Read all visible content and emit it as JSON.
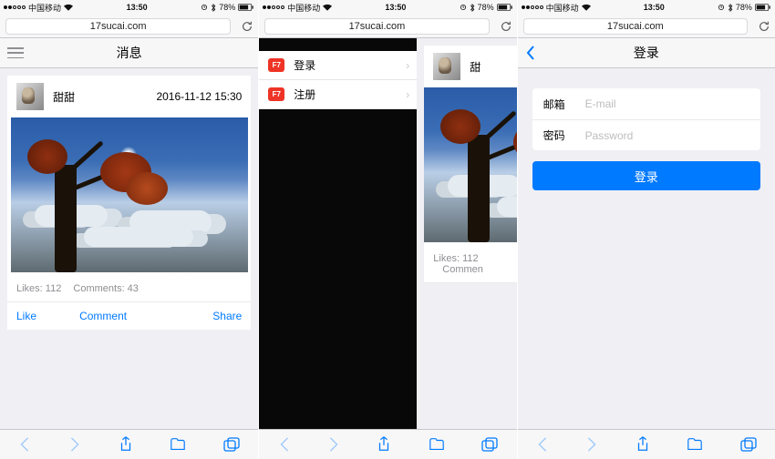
{
  "status": {
    "carrier": "中国移动",
    "signal_icon": "signal",
    "wifi_icon": "wifi",
    "time": "13:50",
    "alarm_icon": "alarm",
    "bt_icon": "bluetooth",
    "battery_pct": "78%",
    "battery_icon": "battery"
  },
  "browser": {
    "url": "17sucai.com",
    "reload_icon": "reload"
  },
  "screen1": {
    "nav_title": "消息",
    "post": {
      "author": "甜甜",
      "date": "2016-11-12 15:30",
      "likes_label": "Likes: 112",
      "comments_label": "Comments: 43",
      "action_like": "Like",
      "action_comment": "Comment",
      "action_share": "Share"
    }
  },
  "screen2": {
    "panel": {
      "badge": "F7",
      "items": [
        {
          "label": "登录"
        },
        {
          "label": "注册"
        }
      ]
    },
    "post": {
      "author": "甜",
      "likes_label": "Likes: 112",
      "comments_prefix": "Commen"
    }
  },
  "screen3": {
    "nav_title": "登录",
    "form": {
      "email_label": "邮箱",
      "email_placeholder": "E-mail",
      "password_label": "密码",
      "password_placeholder": "Password",
      "submit": "登录"
    }
  },
  "toolbar": {
    "back": "back",
    "fwd": "forward",
    "share": "share",
    "books": "bookmarks",
    "tabs": "tabs"
  }
}
